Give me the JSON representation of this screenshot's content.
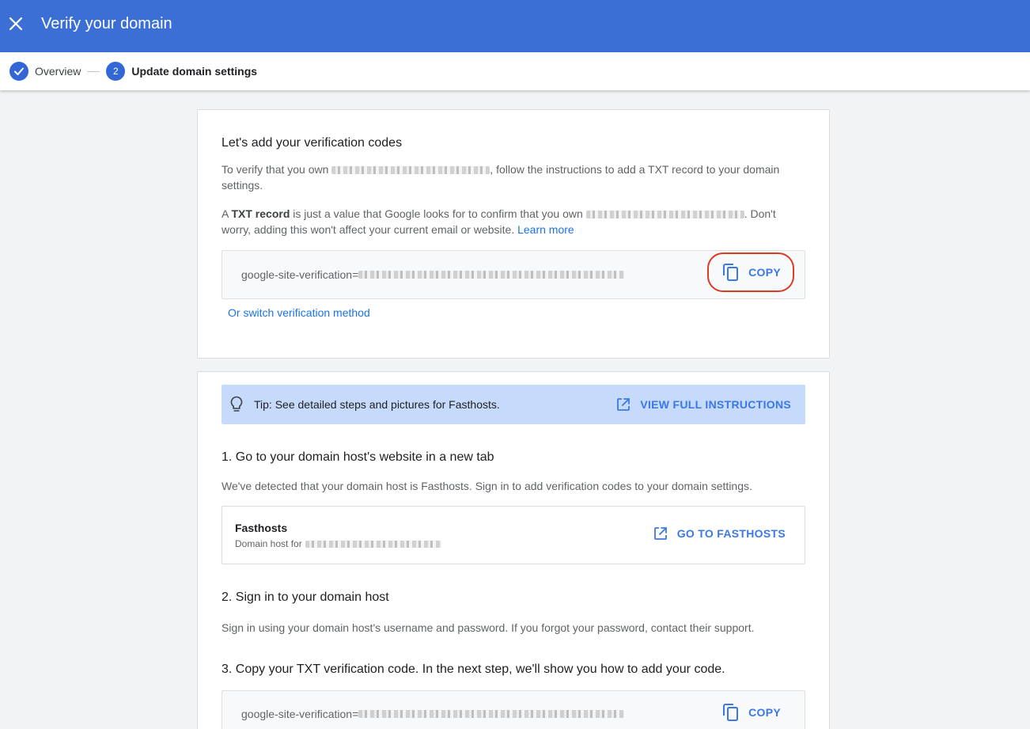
{
  "appbar": {
    "title": "Verify your domain"
  },
  "stepper": {
    "steps": [
      {
        "label": "Overview",
        "state": "done"
      },
      {
        "label": "Update domain settings",
        "number": "2",
        "state": "active"
      }
    ]
  },
  "card1": {
    "heading": "Let's add your verification codes",
    "para1_start": "To verify that you own",
    "para1_end": ", follow the instructions to add a TXT record to your domain settings.",
    "para2_a": "A",
    "para2_bold": "TXT record",
    "para2_b": "is just a value that Google looks for to confirm that you own",
    "para2_c": ". Don't worry, adding this won't affect your current email or website.",
    "learn_more": "Learn more",
    "code_prefix": "google-site-verification=",
    "copy_label": "COPY",
    "switch_link": "Or switch verification method"
  },
  "card2": {
    "tip_text": "Tip: See detailed steps and pictures for Fasthosts.",
    "tip_action": "VIEW FULL INSTRUCTIONS",
    "step1_heading": "1. Go to your domain host's website in a new tab",
    "step1_text": "We've detected that your domain host is Fasthosts. Sign in to add verification codes to your domain settings.",
    "host_name": "Fasthosts",
    "host_sub": "Domain host for",
    "host_action": "GO TO FASTHOSTS",
    "step2_heading": "2. Sign in to your domain host",
    "step2_text": "Sign in using your domain host's username and password. If you forgot your password, contact their support.",
    "step3_heading": "3. Copy your TXT verification code. In the next step, we'll show you how to add your code.",
    "code_prefix": "google-site-verification=",
    "copy_label": "COPY"
  },
  "colors": {
    "appbar": "#3b6fd6",
    "accent": "#3b78e7",
    "highlight": "#d93b25",
    "tip_bg": "#c6dafc"
  },
  "icons": [
    "close-icon",
    "check-icon",
    "copy-icon",
    "lightbulb-icon",
    "open-in-new-icon"
  ]
}
